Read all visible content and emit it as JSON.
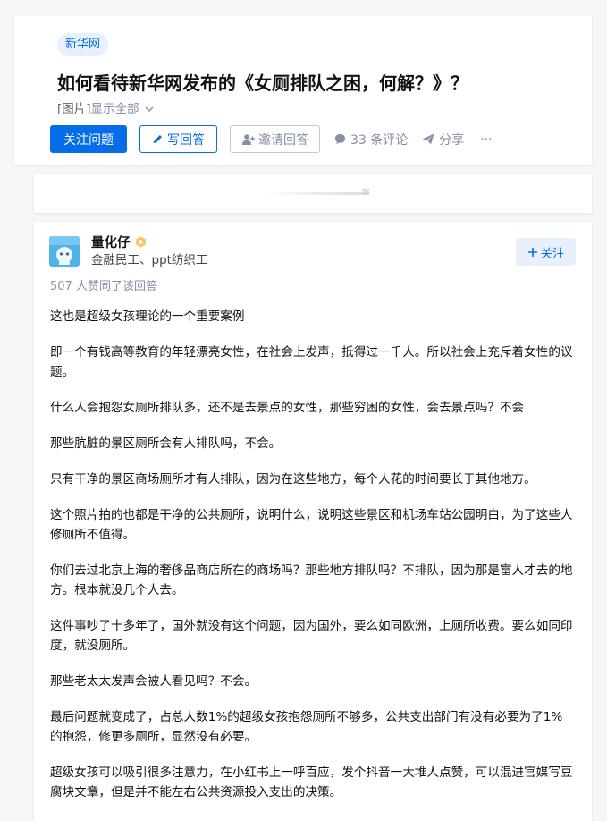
{
  "question": {
    "topic_tag": "新华网",
    "title": "如何看待新华网发布的《女厕排队之困，何解？》？",
    "desc_image": "[图片]",
    "desc_show_all": "显示全部",
    "actions": {
      "follow_question": "关注问题",
      "write_answer": "写回答",
      "invite_answer": "邀请回答",
      "comments": "33 条评论",
      "share": "分享",
      "more": "···"
    }
  },
  "answer": {
    "author": {
      "name": "量化仔",
      "headline": "金融民工、ppt纺织工",
      "badge_icon": "gold-badge-icon"
    },
    "follow_label": "关注",
    "vote_meta": "507 人赞同了该回答",
    "paragraphs": [
      "这也是超级女孩理论的一个重要案例",
      "即一个有钱高等教育的年轻漂亮女性，在社会上发声，抵得过一千人。所以社会上充斥着女性的议题。",
      "什么人会抱怨女厕所排队多，还不是去景点的女性，那些穷困的女性，会去景点吗？不会",
      "那些肮脏的景区厕所会有人排队吗，不会。",
      "只有干净的景区商场厕所才有人排队，因为在这些地方，每个人花的时间要长于其他地方。",
      "这个照片拍的也都是干净的公共厕所，说明什么，说明这些景区和机场车站公园明白，为了这些人修厕所不值得。",
      "你们去过北京上海的奢侈品商店所在的商场吗？那些地方排队吗？不排队，因为那是富人才去的地方。根本就没几个人去。",
      "这件事吵了十多年了，国外就没有这个问题，因为国外，要么如同欧洲，上厕所收费。要么如同印度，就没厕所。",
      "那些老太太发声会被人看见吗？不会。",
      "最后问题就变成了，占总人数1%的超级女孩抱怨厕所不够多，公共支出部门有没有必要为了1%的抱怨，修更多厕所，显然没有必要。",
      "超级女孩可以吸引很多注意力，在小红书上一呼百应，发个抖音一大堆人点赞，可以混进官媒写豆腐块文章，但是并不能左右公共资源投入支出的决策。"
    ]
  },
  "colors": {
    "brand_blue": "#056de8",
    "muted_gray": "#8590a6",
    "tag_bg": "#e8f0fd",
    "page_bg": "#f6f6f6"
  }
}
